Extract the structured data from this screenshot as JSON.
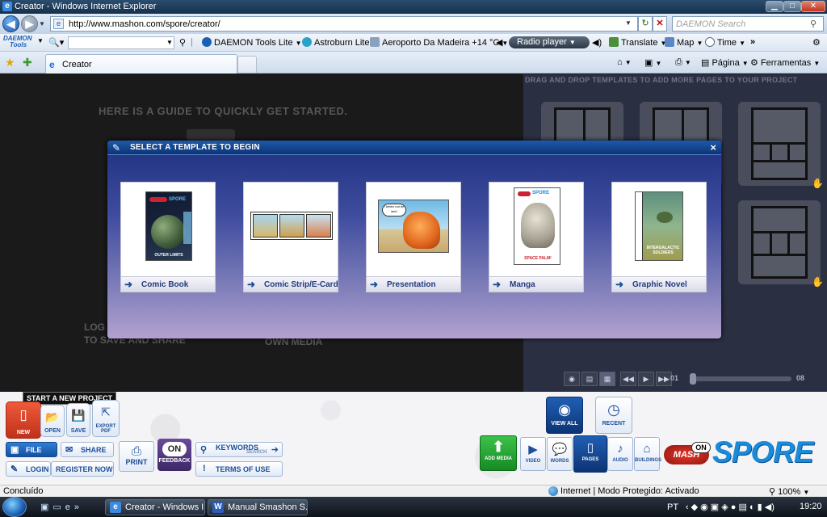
{
  "window": {
    "title": "Creator - Windows Internet Explorer",
    "icon": "ie-icon"
  },
  "address_bar": {
    "url": "http://www.mashon.com/spore/creator/",
    "search_placeholder": "DAEMON Search"
  },
  "links_bar": {
    "daemon_logo_line1": "DAEMON",
    "daemon_logo_line2": "Tools",
    "items": [
      {
        "label": "DAEMON Tools Lite",
        "icon": "daemon-lightning-icon"
      },
      {
        "label": "Astroburn Lite",
        "icon": "astroburn-icon"
      },
      {
        "label": "Aeroporto Da Madeira +14 °C",
        "icon": "weather-plane-icon"
      },
      {
        "label": "Radio player",
        "icon": "radio-icon"
      },
      {
        "label": "Translate",
        "icon": "translate-icon"
      },
      {
        "label": "Map",
        "icon": "map-icon"
      },
      {
        "label": "Time",
        "icon": "clock-icon"
      }
    ],
    "overflow": "»"
  },
  "tabs": {
    "active_label": "Creator"
  },
  "command_bar": {
    "page_label": "Página",
    "tools_label": "Ferramentas"
  },
  "page": {
    "guide_text": "HERE IS A GUIDE TO QUICKLY GET STARTED.",
    "bg_text_login_line1": "LOG",
    "bg_text_login_line2": "TO SAVE AND SHARE",
    "bg_text_media": "OWN MEDIA",
    "templates_hint": "DRAG AND DROP TEMPLATES TO ADD MORE PAGES TO YOUR PROJECT",
    "page_first": "01",
    "page_last": "08"
  },
  "modal": {
    "title": "SELECT A TEMPLATE TO BEGIN",
    "close": "×",
    "templates": [
      {
        "label": "Comic Book",
        "art_caption": "OUTER LIMITS"
      },
      {
        "label": "Comic Strip/E-Card",
        "art_caption": ""
      },
      {
        "label": "Presentation",
        "art_caption": "I better not be late!"
      },
      {
        "label": "Manga",
        "art_caption": "SPACE PALM!"
      },
      {
        "label": "Graphic Novel",
        "art_caption": "INTERGALACTIC SOLDIERS"
      }
    ]
  },
  "toolbar": {
    "tooltip_new": "START A NEW PROJECT",
    "new_label": "NEW",
    "open_label": "OPEN",
    "save_label": "SAVE",
    "export_label": "EXPORT PDF",
    "file_label": "FILE",
    "share_label": "SHARE",
    "keywords_label": "KEYWORDS",
    "keywords_sub": "SEARCH",
    "login_label": "LOGIN",
    "register_label": "REGISTER NOW",
    "terms_label": "TERMS OF USE",
    "print_label": "PRINT",
    "feedback_on": "ON",
    "feedback_label": "FEEDBACK",
    "view_all_label": "VIEW ALL",
    "recent_label": "RECENT",
    "add_media_label": "ADD MEDIA",
    "media_tabs": [
      {
        "label": "VIDEO",
        "icon": "video-icon"
      },
      {
        "label": "WORDS",
        "icon": "speech-bubble-icon"
      },
      {
        "label": "PAGES",
        "icon": "pages-icon"
      },
      {
        "label": "AUDIO",
        "icon": "music-note-icon"
      },
      {
        "label": "BUILDINGS",
        "icon": "building-icon"
      }
    ],
    "mash_logo": "MASH",
    "mash_on": "ON",
    "spore_logo": "SPORE"
  },
  "status_bar": {
    "left": "Concluído",
    "zone": "Internet | Modo Protegido: Activado",
    "zoom": "100%"
  },
  "taskbar": {
    "buttons": [
      {
        "label": "Creator - Windows I...",
        "icon": "ie-icon"
      },
      {
        "label": "Manual Smashon S...",
        "icon": "word-icon"
      }
    ],
    "language": "PT",
    "clock": "19:20"
  },
  "colors": {
    "modal_header": "#0d3475",
    "accent_blue": "#1d4f9b",
    "new_button": "#e04428",
    "add_media_green": "#28a836",
    "feedback_purple": "#533a80",
    "spore_blue": "#1a8bd8"
  }
}
